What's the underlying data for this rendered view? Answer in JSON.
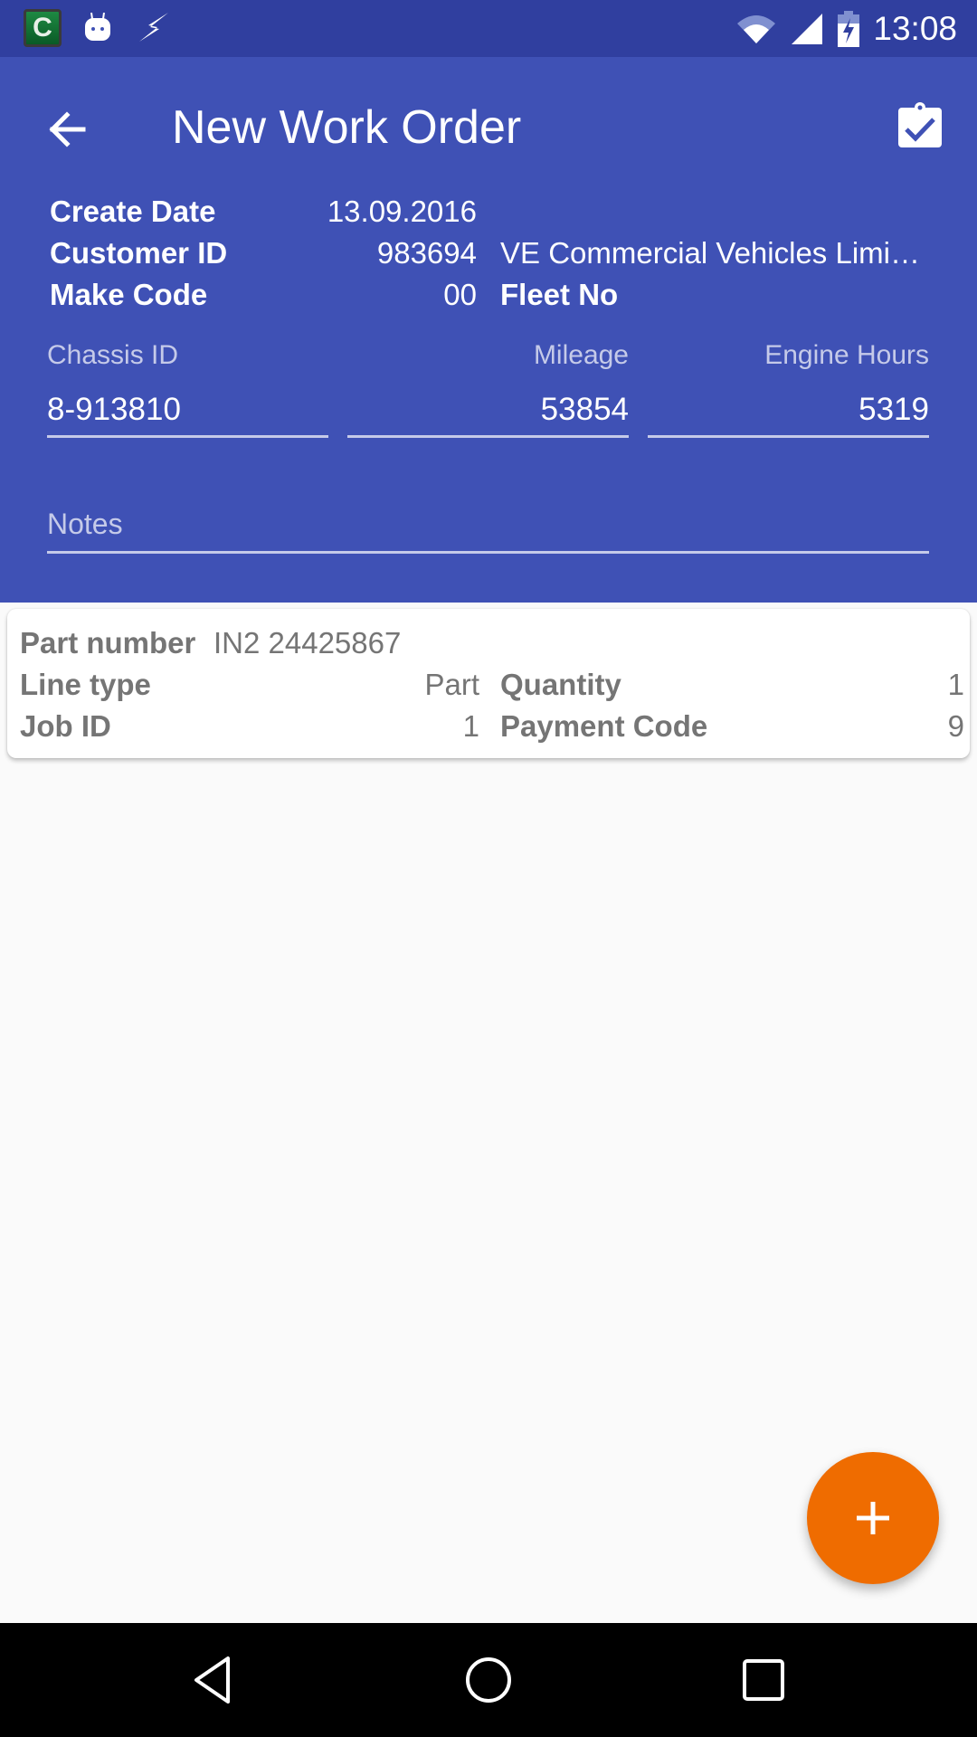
{
  "status_bar": {
    "time": "13:08",
    "notification_icons": [
      "app-c-icon",
      "android-bot-icon",
      "bolt-icon"
    ],
    "system_icons": [
      "wifi-icon",
      "signal-icon",
      "battery-charging-icon"
    ],
    "app_icon_letter": "C"
  },
  "toolbar": {
    "title": "New Work Order",
    "back_icon": "arrow-left-icon",
    "action_icon": "clipboard-check-icon"
  },
  "info": {
    "create_date_label": "Create Date",
    "create_date_value": "13.09.2016",
    "customer_id_label": "Customer ID",
    "customer_id_value": "983694",
    "customer_name": "VE Commercial Vehicles Limi…",
    "make_code_label": "Make Code",
    "make_code_value": "00",
    "fleet_no_label": "Fleet No"
  },
  "fields": {
    "chassis_label": "Chassis ID",
    "chassis_value": "8-913810",
    "mileage_label": "Mileage",
    "mileage_value": "53854",
    "engine_hours_label": "Engine Hours",
    "engine_hours_value": "5319",
    "notes_placeholder": "Notes"
  },
  "line_item": {
    "part_number_label": "Part number",
    "part_number_value": "IN2 24425867",
    "line_type_label": "Line type",
    "line_type_value": "Part",
    "quantity_label": "Quantity",
    "quantity_value": "1",
    "job_id_label": "Job ID",
    "job_id_value": "1",
    "payment_code_label": "Payment Code",
    "payment_code_value": "9"
  },
  "fab": {
    "icon": "plus-icon"
  },
  "nav": {
    "icons": [
      "nav-back-icon",
      "nav-home-icon",
      "nav-recents-icon"
    ]
  },
  "colors": {
    "status_bar": "#303f9f",
    "primary": "#3f51b5",
    "accent": "#ef6c00",
    "field_hint": "#c5cae9",
    "card_text": "#757575"
  }
}
